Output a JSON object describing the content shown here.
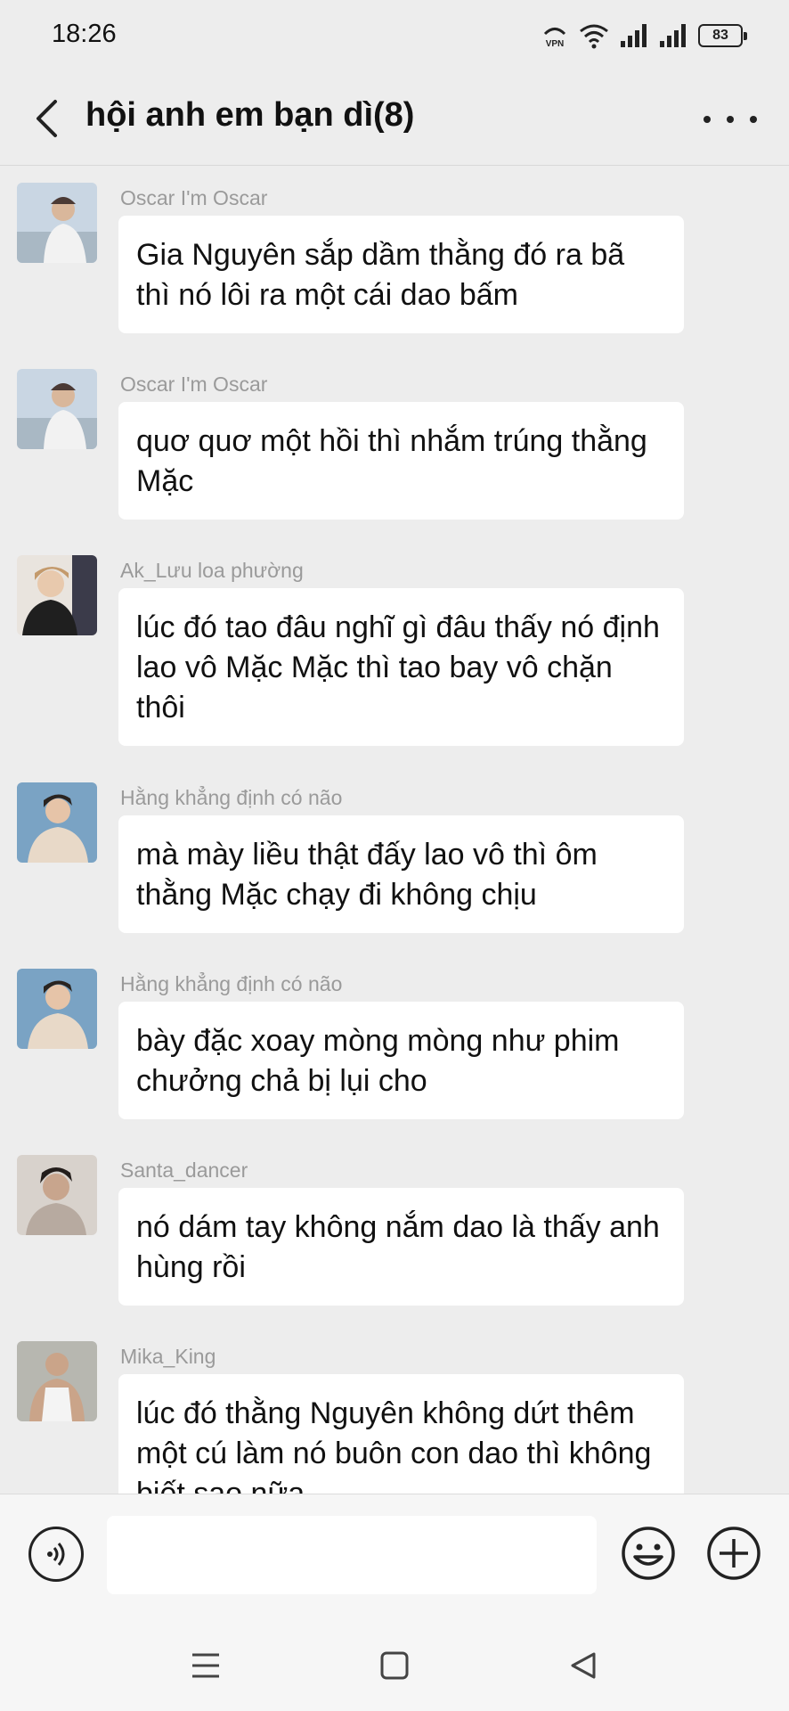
{
  "status_bar": {
    "time": "18:26",
    "vpn_label": "VPN",
    "battery": "83"
  },
  "header": {
    "title": "hội anh em bạn dì(8)"
  },
  "messages": [
    {
      "sender": "Oscar I'm Oscar",
      "text": "Gia Nguyên sắp dầm thằng đó ra bã thì nó lôi ra một cái dao bấm",
      "avatar_colors": [
        "#c9d6e3",
        "#f2f2f2",
        "#6b5a52"
      ]
    },
    {
      "sender": "Oscar I'm Oscar",
      "text": "quơ quơ một hồi thì nhắm trúng thằng Mặc",
      "avatar_colors": [
        "#c9d6e3",
        "#f2f2f2",
        "#6b5a52"
      ]
    },
    {
      "sender": "Ak_Lưu loa phường",
      "text": "lúc đó tao đâu nghĩ gì đâu thấy nó định lao vô Mặc Mặc thì tao bay vô chặn thôi",
      "avatar_colors": [
        "#e9e4de",
        "#1f1f1f",
        "#c49a6c"
      ]
    },
    {
      "sender": "Hằng khẳng định có não",
      "text": "mà mày liều thật đấy lao vô thì ôm thằng Mặc chạy đi không chịu",
      "avatar_colors": [
        "#7aa3c4",
        "#e8d9c8",
        "#2a2420"
      ]
    },
    {
      "sender": "Hằng khẳng định có não",
      "text": "bày đặc xoay mòng mòng như phim chưởng chả bị lụi cho",
      "avatar_colors": [
        "#7aa3c4",
        "#e8d9c8",
        "#2a2420"
      ]
    },
    {
      "sender": "Santa_dancer",
      "text": "nó dám tay không nắm dao là thấy anh hùng rồi",
      "avatar_colors": [
        "#d8d2cc",
        "#b7aaa0",
        "#231d1a"
      ]
    },
    {
      "sender": "Mika_King",
      "text": "lúc đó thằng Nguyên không dứt thêm một cú làm nó buôn con dao thì không biết sao nữa",
      "avatar_colors": [
        "#b7b7b0",
        "#f4f4f4",
        "#caa489"
      ]
    }
  ],
  "input": {
    "placeholder": ""
  },
  "icons": {
    "back": "chevron-left-icon",
    "more": "more-dots-icon",
    "voice": "voice-icon",
    "emoji": "emoji-icon",
    "plus": "plus-icon",
    "nav_menu": "menu-icon",
    "nav_home": "home-square-icon",
    "nav_back": "back-triangle-icon"
  }
}
